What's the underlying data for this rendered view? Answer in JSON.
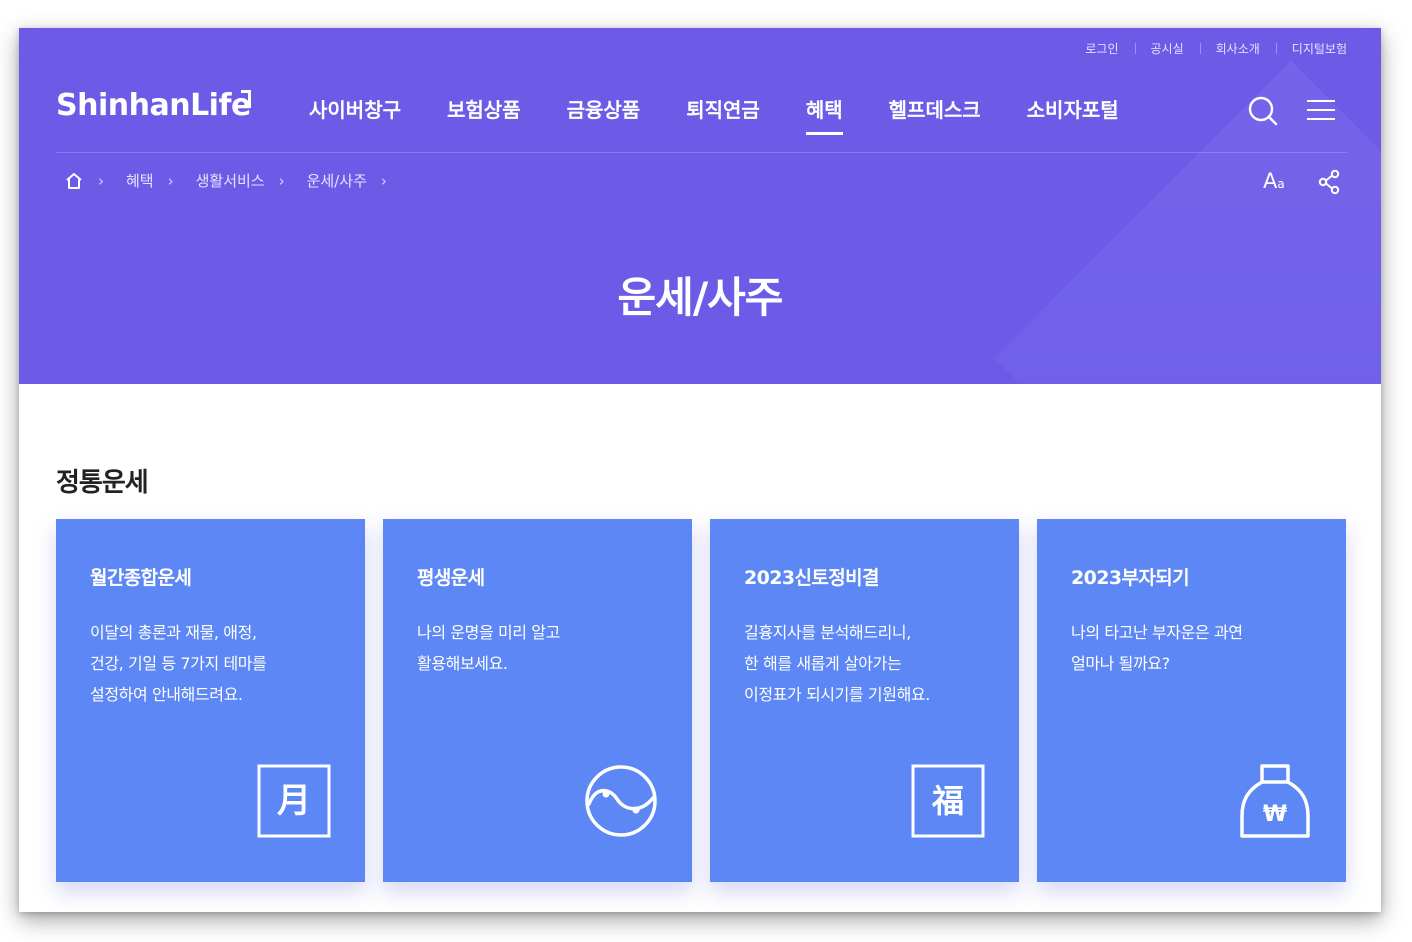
{
  "utility_links": [
    "로그인",
    "공시실",
    "회사소개",
    "디지털보험"
  ],
  "logo": {
    "text": "ShinhanLife"
  },
  "gnb": [
    {
      "label": "사이버창구",
      "active": false
    },
    {
      "label": "보험상품",
      "active": false
    },
    {
      "label": "금융상품",
      "active": false
    },
    {
      "label": "퇴직연금",
      "active": false
    },
    {
      "label": "혜택",
      "active": true
    },
    {
      "label": "헬프데스크",
      "active": false
    },
    {
      "label": "소비자포털",
      "active": false
    }
  ],
  "header_icons": [
    "search-icon",
    "menu-icon",
    "font-size-icon",
    "share-icon"
  ],
  "font_button": {
    "big": "A",
    "small": "a"
  },
  "breadcrumb": [
    "혜택",
    "생활서비스",
    "운세/사주"
  ],
  "page_title": "운세/사주",
  "section_title": "정통운세",
  "cards": [
    {
      "title": "월간종합운세",
      "desc": "이달의 총론과 재물, 애정,\n건강, 기일 등 7가지 테마를\n설정하여 안내해드려요.",
      "icon": "calendar-month-icon",
      "glyph": "月"
    },
    {
      "title": "평생운세",
      "desc": "나의 운명을 미리 알고\n활용해보세요.",
      "icon": "yin-yang-icon",
      "glyph": ""
    },
    {
      "title": "2023신토정비결",
      "desc": "길흉지사를 분석해드리니,\n한 해를 새롭게 살아가는\n이정표가 되시기를 기원해요.",
      "icon": "fortune-character-icon",
      "glyph": "福"
    },
    {
      "title": "2023부자되기",
      "desc": "나의 타고난 부자운은 과연\n얼마나 될까요?",
      "icon": "money-bag-icon",
      "glyph": "₩"
    }
  ],
  "colors": {
    "hero_bg": "#6d5be8",
    "card_bg": "#5c87f5",
    "text_dark": "#222222"
  }
}
